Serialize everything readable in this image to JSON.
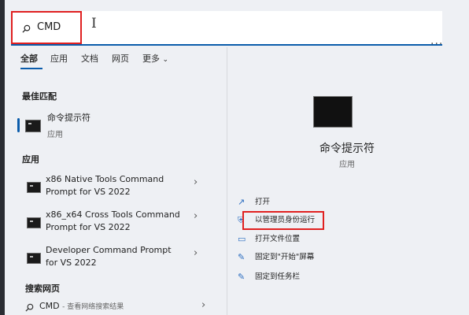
{
  "search": {
    "value": "CMD"
  },
  "tabs": [
    {
      "label": "全部",
      "active": true
    },
    {
      "label": "应用"
    },
    {
      "label": "文档"
    },
    {
      "label": "网页"
    },
    {
      "label": "更多"
    }
  ],
  "sections": {
    "best_match": "最佳匹配",
    "apps": "应用",
    "web": "搜索网页"
  },
  "best_match": {
    "title": "命令提示符",
    "subtitle": "应用"
  },
  "apps": [
    {
      "line1": "x86 Native Tools Command",
      "line2": "Prompt for VS 2022"
    },
    {
      "line1": "x86_x64 Cross Tools Command",
      "line2": "Prompt for VS 2022"
    },
    {
      "line1": "Developer Command Prompt",
      "line2": "for VS 2022"
    }
  ],
  "web_result": {
    "query": "CMD",
    "suffix": "- 查看网络搜索结果"
  },
  "detail": {
    "title": "命令提示符",
    "subtitle": "应用",
    "actions": [
      {
        "label": "打开",
        "icon": "open-icon"
      },
      {
        "label": "以管理员身份运行",
        "icon": "shield-icon"
      },
      {
        "label": "打开文件位置",
        "icon": "folder-icon"
      },
      {
        "label": "固定到\"开始\"屏幕",
        "icon": "pin-icon"
      },
      {
        "label": "固定到任务栏",
        "icon": "pin-icon"
      }
    ]
  },
  "colors": {
    "accent": "#0b5cab",
    "highlight": "#e02020",
    "panel": "#eef0f4"
  }
}
